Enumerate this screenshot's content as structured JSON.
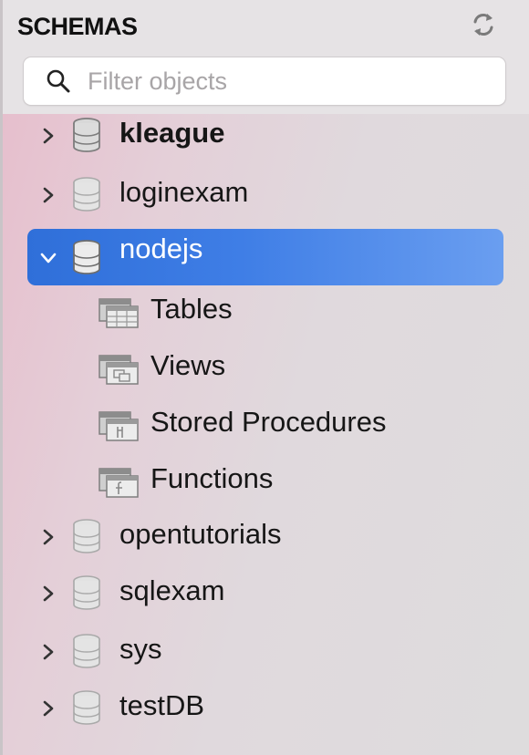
{
  "header": {
    "title": "SCHEMAS",
    "refresh_icon": "refresh-icon"
  },
  "search": {
    "placeholder": "Filter objects",
    "value": "",
    "icon": "search-icon"
  },
  "colors": {
    "selection": "#3f7ee6",
    "header_bg": "#e6e3e5"
  },
  "schemas": [
    {
      "label": "kleague",
      "expanded": false,
      "bold": true
    },
    {
      "label": "loginexam",
      "expanded": false
    },
    {
      "label": "nodejs",
      "expanded": true,
      "selected": true,
      "children": [
        {
          "label": "Tables",
          "icon": "tables-folder-icon"
        },
        {
          "label": "Views",
          "icon": "views-folder-icon"
        },
        {
          "label": "Stored Procedures",
          "icon": "procedures-folder-icon"
        },
        {
          "label": "Functions",
          "icon": "functions-folder-icon"
        }
      ]
    },
    {
      "label": "opentutorials",
      "expanded": false
    },
    {
      "label": "sqlexam",
      "expanded": false
    },
    {
      "label": "sys",
      "expanded": false
    },
    {
      "label": "testDB",
      "expanded": false
    }
  ]
}
